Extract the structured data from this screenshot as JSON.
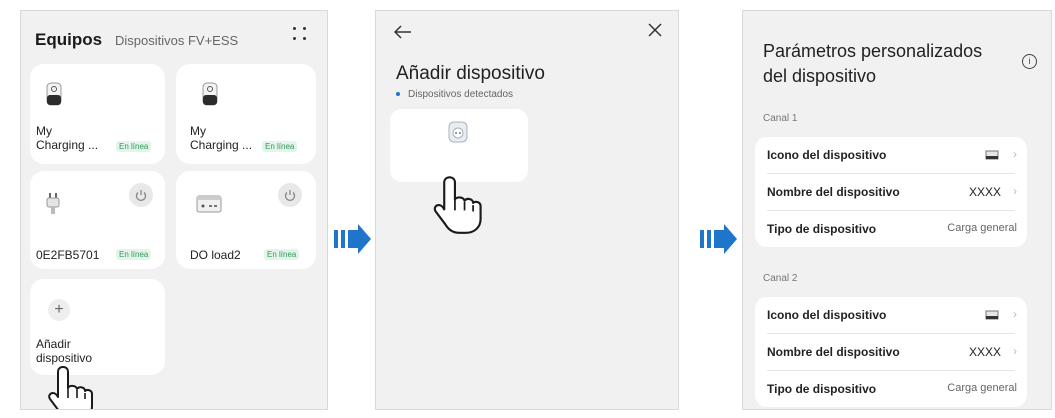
{
  "colors": {
    "accent": "#1f75c9",
    "online_text": "#2e9a5a",
    "online_bg": "#e3f4ea"
  },
  "screen1": {
    "title": "Equipos",
    "subtitle": "Dispositivos FV+ESS",
    "menu_icon": "dots-grid-icon",
    "devices": [
      {
        "name": "My\nCharging ...",
        "status": "En línea",
        "icon": "charger-icon",
        "has_power": false
      },
      {
        "name": "My\nCharging ...",
        "status": "En línea",
        "icon": "charger-icon",
        "has_power": false
      },
      {
        "name": "0E2FB5701",
        "status": "En línea",
        "icon": "plug-icon",
        "has_power": true
      },
      {
        "name": "DO load2",
        "status": "En línea",
        "icon": "switch-box-icon",
        "has_power": true
      }
    ],
    "add_label": "Añadir\ndispositivo",
    "add_icon": "plus-icon"
  },
  "screen2": {
    "back_icon": "arrow-left-icon",
    "close_icon": "close-icon",
    "title": "Añadir dispositivo",
    "subtitle": "Dispositivos detectados",
    "detected_icon": "smart-socket-icon"
  },
  "screen3": {
    "title": "Parámetros personalizados\ndel dispositivo",
    "info_icon": "info-icon",
    "channels": [
      {
        "label": "Canal 1",
        "rows": [
          {
            "label": "Icono del dispositivo",
            "value": "",
            "chevron": true,
            "icon": "device-thumb-icon"
          },
          {
            "label": "Nombre del dispositivo",
            "value": "XXXX",
            "chevron": true
          },
          {
            "label": "Tipo de dispositivo",
            "value": "Carga general",
            "chevron": false
          }
        ]
      },
      {
        "label": "Canal 2",
        "rows": [
          {
            "label": "Icono del dispositivo",
            "value": "",
            "chevron": true,
            "icon": "device-thumb-icon"
          },
          {
            "label": "Nombre del dispositivo",
            "value": "XXXX",
            "chevron": true
          },
          {
            "label": "Tipo de dispositivo",
            "value": "Carga general",
            "chevron": false
          }
        ]
      }
    ]
  },
  "flow_arrow_icon": "next-step-arrow-icon",
  "hand_icon": "tap-hand-icon"
}
